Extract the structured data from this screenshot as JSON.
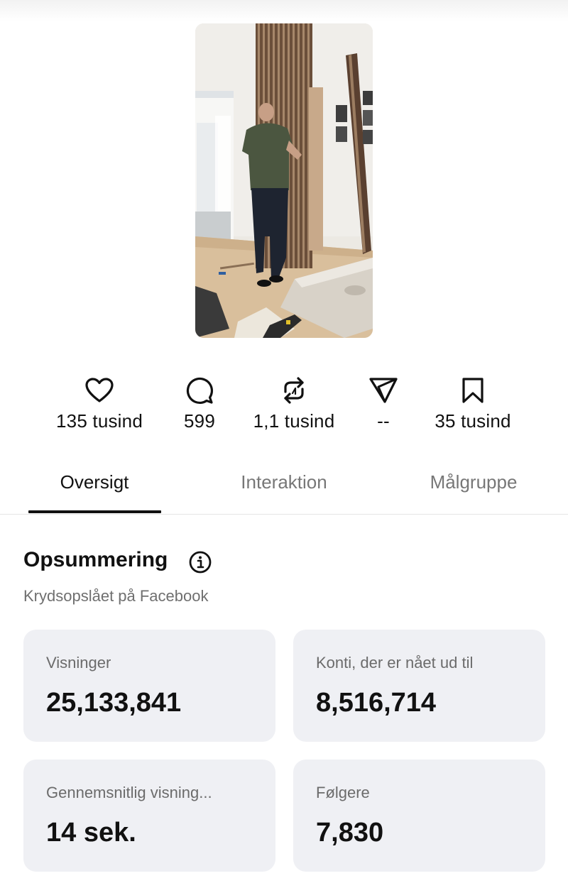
{
  "video": {
    "thumbnail_icon": "video-thumbnail-man-installing-wall-panels"
  },
  "engagement": [
    {
      "icon": "heart-icon",
      "value": "135 tusind"
    },
    {
      "icon": "comment-icon",
      "value": "599"
    },
    {
      "icon": "repost-icon",
      "value": "1,1 tusind"
    },
    {
      "icon": "share-icon",
      "value": "--"
    },
    {
      "icon": "bookmark-icon",
      "value": "35 tusind"
    }
  ],
  "tabs": [
    {
      "label": "Oversigt",
      "active": true
    },
    {
      "label": "Interaktion",
      "active": false
    },
    {
      "label": "Målgruppe",
      "active": false
    }
  ],
  "summary": {
    "title": "Opsummering",
    "info_icon": "info-icon",
    "subtitle": "Krydsopslået på Facebook",
    "cards": [
      {
        "label": "Visninger",
        "value": "25,133,841"
      },
      {
        "label": "Konti, der er nået ud til",
        "value": "8,516,714"
      },
      {
        "label": "Gennemsnitlig visning...",
        "value": "14 sek."
      },
      {
        "label": "Følgere",
        "value": "7,830"
      }
    ]
  },
  "colors": {
    "card_bg": "#eff0f4",
    "active_tab_underline": "#111111",
    "muted_text": "#6f6f6f"
  }
}
